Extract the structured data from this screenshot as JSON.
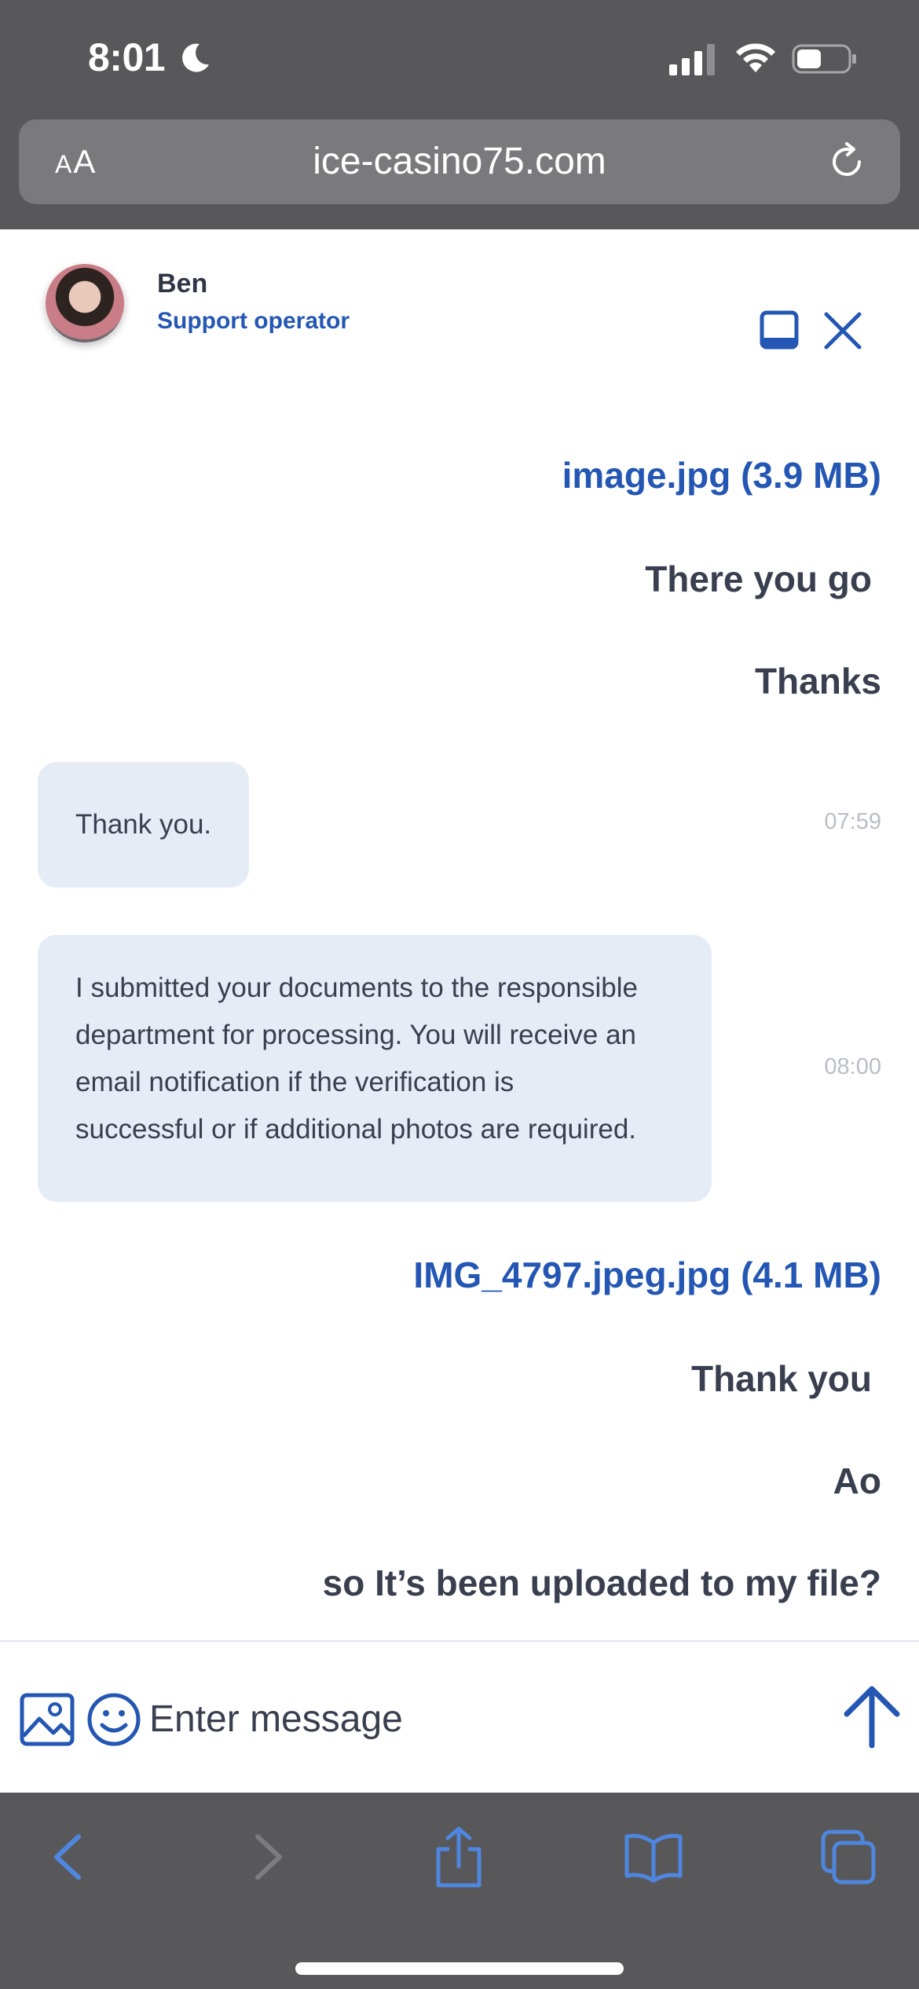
{
  "status_bar": {
    "time": "8:01"
  },
  "browser": {
    "aa_label_small": "A",
    "aa_label_large": "A",
    "url": "ice-casino75.com"
  },
  "chat_header": {
    "operator_name": "Ben",
    "operator_role": "Support operator"
  },
  "messages": [
    {
      "side": "user",
      "type": "file",
      "text": "image.jpg (3.9 MB)"
    },
    {
      "side": "user",
      "type": "text",
      "text": "There you go"
    },
    {
      "side": "user",
      "type": "text",
      "text": "Thanks"
    },
    {
      "side": "operator",
      "type": "text",
      "text": "Thank you.",
      "time": "07:59"
    },
    {
      "side": "operator",
      "type": "text",
      "lines": [
        "I submitted your documents to the responsible",
        "department for processing. You will receive an",
        "email notification if the verification is",
        "successful or if additional photos are required."
      ],
      "time": "08:00"
    },
    {
      "side": "user",
      "type": "file",
      "text": "IMG_4797.jpeg.jpg (4.1 MB)"
    },
    {
      "side": "user",
      "type": "text",
      "text": "Thank you"
    },
    {
      "side": "user",
      "type": "text",
      "text": "Ao"
    },
    {
      "side": "user",
      "type": "text",
      "text": "so It’s been uploaded to my file?"
    }
  ],
  "composer": {
    "placeholder": "Enter message",
    "value": ""
  },
  "icons": {
    "status": [
      "moon-icon",
      "signal-icon",
      "wifi-icon",
      "battery-icon"
    ],
    "header": [
      "minimize-icon",
      "close-icon"
    ],
    "composer": [
      "image-icon",
      "emoji-icon",
      "send-arrow-icon"
    ],
    "toolbar": [
      "back-icon",
      "forward-icon",
      "share-icon",
      "bookmarks-icon",
      "tabs-icon"
    ]
  },
  "colors": {
    "accent": "#2457b3",
    "chrome": "#58585a",
    "bubble": "#e6ecf6",
    "text": "#3a3f4f",
    "timestamp": "#b9bdc6",
    "toolbar_icon": "#4f86e0"
  }
}
